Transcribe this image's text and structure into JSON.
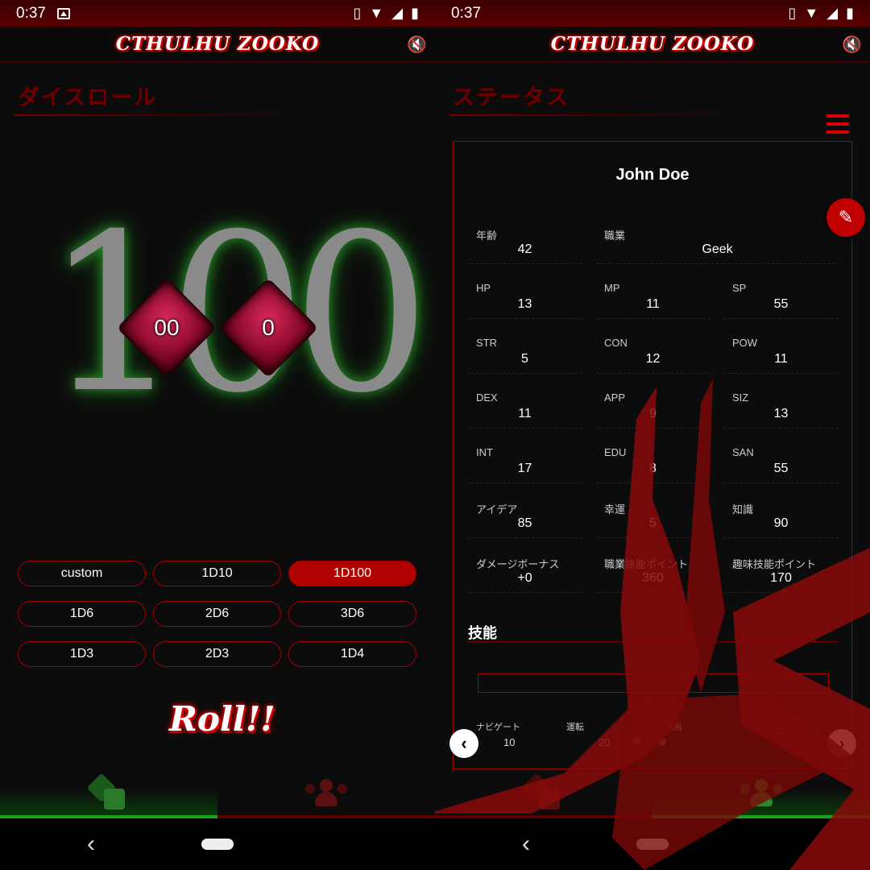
{
  "status_bar": {
    "time": "0:37"
  },
  "app": {
    "logo_text": "CTHULHU ZOOKO"
  },
  "dice_screen": {
    "title": "ダイスロール",
    "result": "100",
    "dice": [
      {
        "face": "00"
      },
      {
        "face": "0"
      }
    ],
    "buttons": [
      {
        "label": "custom",
        "active": false
      },
      {
        "label": "1D10",
        "active": false
      },
      {
        "label": "1D100",
        "active": true
      },
      {
        "label": "1D6",
        "active": false
      },
      {
        "label": "2D6",
        "active": false
      },
      {
        "label": "3D6",
        "active": false
      },
      {
        "label": "1D3",
        "active": false
      },
      {
        "label": "2D3",
        "active": false
      },
      {
        "label": "1D4",
        "active": false
      }
    ],
    "roll_label": "Roll!!"
  },
  "status_screen": {
    "title": "ステータス",
    "character_name": "John Doe",
    "fields": {
      "age": {
        "label": "年齢",
        "value": "42"
      },
      "job": {
        "label": "職業",
        "value": "Geek"
      },
      "hp": {
        "label": "HP",
        "value": "13"
      },
      "mp": {
        "label": "MP",
        "value": "11"
      },
      "sp": {
        "label": "SP",
        "value": "55"
      },
      "str": {
        "label": "STR",
        "value": "5"
      },
      "con": {
        "label": "CON",
        "value": "12"
      },
      "pow": {
        "label": "POW",
        "value": "11"
      },
      "dex": {
        "label": "DEX",
        "value": "11"
      },
      "app": {
        "label": "APP",
        "value": "9"
      },
      "siz": {
        "label": "SIZ",
        "value": "13"
      },
      "int": {
        "label": "INT",
        "value": "17"
      },
      "edu": {
        "label": "EDU",
        "value": "8"
      },
      "san": {
        "label": "SAN",
        "value": "55"
      },
      "idea": {
        "label": "アイデア",
        "value": "85"
      },
      "luck": {
        "label": "幸運",
        "value": "5"
      },
      "know": {
        "label": "知識",
        "value": "90"
      },
      "db": {
        "label": "ダメージボーナス",
        "value": "+0"
      },
      "job_pts": {
        "label": "職業技能ポイント",
        "value": "360"
      },
      "hobby_pts": {
        "label": "趣味技能ポイント",
        "value": "170"
      }
    },
    "skills_title": "技能",
    "skills": [
      {
        "name": "ナビゲート",
        "value": "10"
      },
      {
        "name": "運転",
        "value": "20"
      },
      {
        "name": "乗馬",
        "value": ""
      },
      {
        "name": "",
        "value": "25"
      }
    ]
  },
  "colors": {
    "accent": "#b00000",
    "active_tab": "#1aa01a",
    "bg": "#0c0c0c"
  },
  "icons": [
    "image-icon",
    "vibrate-icon",
    "wifi-icon",
    "signal-icon",
    "battery-icon",
    "mute-icon",
    "dice-icon",
    "people-icon",
    "list-icon",
    "edit-icon",
    "back-icon",
    "home-icon"
  ]
}
